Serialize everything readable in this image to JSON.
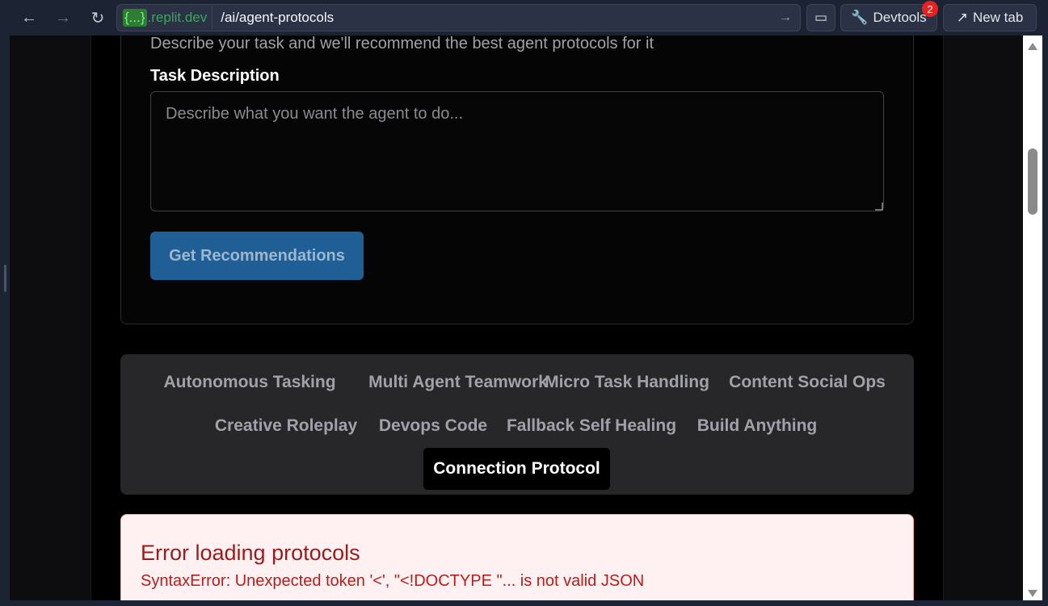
{
  "browser": {
    "domain_badge": "{...}",
    "domain": ".replit.dev",
    "path": "/ai/agent-protocols",
    "devtools_label": "Devtools",
    "devtools_badge": "2",
    "newtab_label": "New tab"
  },
  "form": {
    "description": "Describe your task and we'll recommend the best agent protocols for it",
    "task_label": "Task Description",
    "task_placeholder": "Describe what you want the agent to do...",
    "submit_label": "Get Recommendations"
  },
  "tabs": [
    {
      "label": "Autonomous Tasking",
      "active": false
    },
    {
      "label": "Multi Agent Teamwork",
      "active": false
    },
    {
      "label": "Micro Task Handling",
      "active": false
    },
    {
      "label": "Content Social Ops",
      "active": false
    },
    {
      "label": "Creative Roleplay",
      "active": false
    },
    {
      "label": "Devops Code",
      "active": false
    },
    {
      "label": "Fallback Self Healing",
      "active": false
    },
    {
      "label": "Build Anything",
      "active": false
    },
    {
      "label": "Connection Protocol",
      "active": true
    }
  ],
  "error": {
    "title": "Error loading protocols",
    "message": "SyntaxError: Unexpected token '<', \"<!DOCTYPE \"... is not valid JSON"
  },
  "colors": {
    "primary_button": "#1f5f96",
    "error_title": "#991b1b",
    "error_bg": "#fff1f1"
  }
}
